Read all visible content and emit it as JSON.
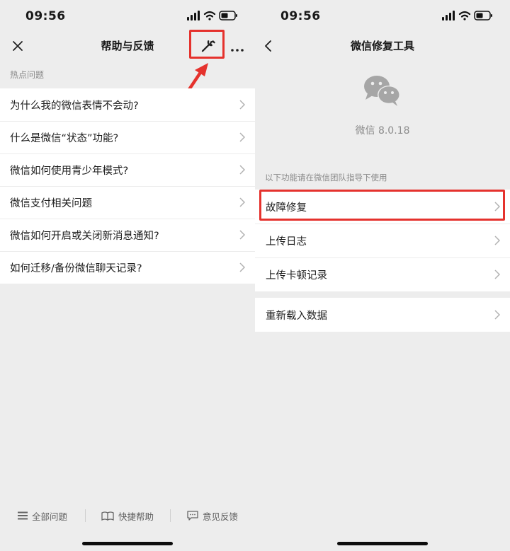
{
  "left": {
    "status": {
      "time": "09:56"
    },
    "title": "帮助与反馈",
    "section_label": "热点问题",
    "questions": [
      "为什么我的微信表情不会动?",
      "什么是微信“状态”功能?",
      "微信如何使用青少年模式?",
      "微信支付相关问题",
      "微信如何开启或关闭新消息通知?",
      "如何迁移/备份微信聊天记录?"
    ],
    "bottom_tabs": [
      {
        "label": "全部问题",
        "icon": "list-icon"
      },
      {
        "label": "快捷帮助",
        "icon": "book-icon"
      },
      {
        "label": "意见反馈",
        "icon": "chat-bubble-icon"
      }
    ]
  },
  "right": {
    "status": {
      "time": "09:56"
    },
    "title": "微信修复工具",
    "app_version": "微信 8.0.18",
    "section_label": "以下功能请在微信团队指导下使用",
    "items": [
      "故障修复",
      "上传日志",
      "上传卡顿记录"
    ],
    "extra_item": "重新载入数据"
  },
  "colors": {
    "background": "#ededed",
    "highlight_red": "#e5322d"
  }
}
